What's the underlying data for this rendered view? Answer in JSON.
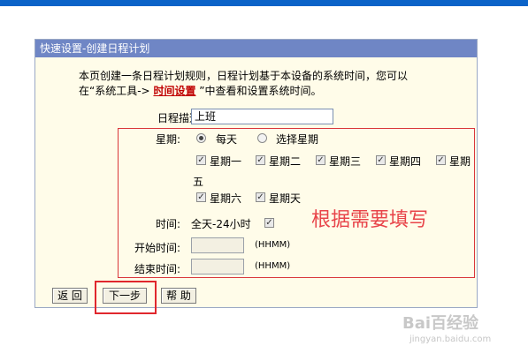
{
  "panel": {
    "title": "快速设置-创建日程计划",
    "intro_line1": "本页创建一条日程计划规则，日程计划基于本设备的系统时间，您可以",
    "intro_line2_prefix": "在“系统工具->",
    "intro_link": "时间设置",
    "intro_line2_suffix": "”中查看和设置系统时间。"
  },
  "form": {
    "desc_label": "日程描述:",
    "desc_value": "上班",
    "week_label": "星期:",
    "every_day": "每天",
    "select_week": "选择星期",
    "every_day_checked": true,
    "days": [
      "星期一",
      "星期二",
      "星期三",
      "星期四",
      "星期",
      "星期六",
      "星期天"
    ],
    "day_wrap": "五",
    "time_label": "时间:",
    "all_day": "全天-24小时",
    "all_day_checked": true,
    "start_label": "开始时间:",
    "end_label": "结束时间:",
    "time_format": "(HHMM)"
  },
  "annotation": "根据需要填写",
  "buttons": {
    "back": "返 回",
    "next": "下一步",
    "help": "帮 助"
  },
  "watermark": {
    "main": "Bai百经验",
    "sub": "jingyan.baidu.com"
  },
  "colors": {
    "title_bar": "#6f86c5",
    "panel_bg": "#fffce9",
    "highlight": "#e0272d",
    "top_bar": "#0b63c8"
  }
}
